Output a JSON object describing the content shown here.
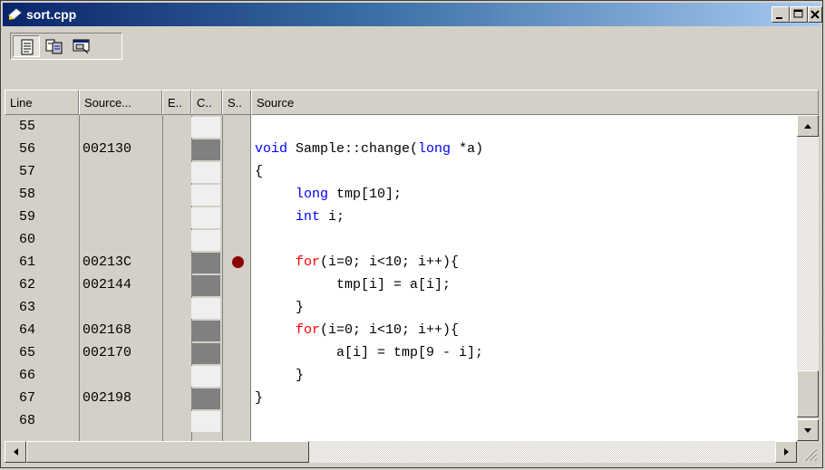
{
  "window": {
    "title": "sort.cpp"
  },
  "columns": [
    {
      "label": "Line"
    },
    {
      "label": "Source..."
    },
    {
      "label": "E.."
    },
    {
      "label": "C.."
    },
    {
      "label": "S.."
    },
    {
      "label": "Source"
    }
  ],
  "rows": [
    {
      "line": "55",
      "address": "",
      "code": []
    },
    {
      "line": "56",
      "address": "002130",
      "code": [
        {
          "t": "void",
          "c": "b"
        },
        {
          "t": " Sample::change("
        },
        {
          "t": "long",
          "c": "b"
        },
        {
          "t": " *a)"
        }
      ]
    },
    {
      "line": "57",
      "address": "",
      "code": [
        {
          "t": "{"
        }
      ]
    },
    {
      "line": "58",
      "address": "",
      "code": [
        {
          "t": "     "
        },
        {
          "t": "long",
          "c": "b"
        },
        {
          "t": " tmp[10];"
        }
      ]
    },
    {
      "line": "59",
      "address": "",
      "code": [
        {
          "t": "     "
        },
        {
          "t": "int",
          "c": "b"
        },
        {
          "t": " i;"
        }
      ]
    },
    {
      "line": "60",
      "address": "",
      "code": []
    },
    {
      "line": "61",
      "address": "00213C",
      "code": [
        {
          "t": "     "
        },
        {
          "t": "for",
          "c": "r"
        },
        {
          "t": "(i=0; i<10; i++){"
        }
      ]
    },
    {
      "line": "62",
      "address": "002144",
      "code": [
        {
          "t": "          tmp[i] = a[i];"
        }
      ]
    },
    {
      "line": "63",
      "address": "",
      "code": [
        {
          "t": "     }"
        }
      ]
    },
    {
      "line": "64",
      "address": "002168",
      "code": [
        {
          "t": "     "
        },
        {
          "t": "for",
          "c": "r"
        },
        {
          "t": "(i=0; i<10; i++){"
        }
      ]
    },
    {
      "line": "65",
      "address": "002170",
      "code": [
        {
          "t": "          a[i] = tmp[9 - i];"
        }
      ]
    },
    {
      "line": "66",
      "address": "",
      "code": [
        {
          "t": "     }"
        }
      ]
    },
    {
      "line": "67",
      "address": "002198",
      "code": [
        {
          "t": "}"
        }
      ]
    },
    {
      "line": "68",
      "address": "",
      "code": []
    }
  ],
  "breakpoint_line": "61",
  "icons": [
    "document-icon",
    "file-icon",
    "window-icon",
    "minimize-icon",
    "maximize-icon",
    "close-icon"
  ],
  "colors": {
    "keyword_blue": "#0000ff",
    "keyword_red": "#ff0000",
    "breakpoint": "#8b0000",
    "coverage": "#808080"
  }
}
